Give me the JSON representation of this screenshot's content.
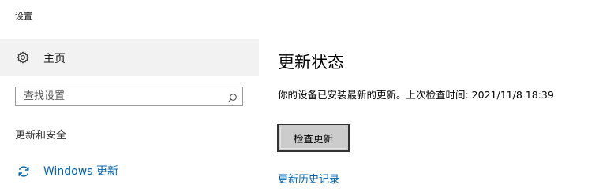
{
  "window": {
    "title": "设置"
  },
  "sidebar": {
    "home": {
      "label": "主页",
      "icon": "gear-icon"
    },
    "search": {
      "placeholder": "查找设置",
      "value": "",
      "icon": "search-icon"
    },
    "section_title": "更新和安全",
    "items": [
      {
        "label": "Windows 更新",
        "icon": "refresh-icon",
        "active": true
      }
    ]
  },
  "main": {
    "title": "更新状态",
    "status_text": "你的设备已安装最新的更新。上次检查时间: 2021/11/8 18:39",
    "check_button_label": "检查更新",
    "history_link": "更新历史记录"
  },
  "colors": {
    "accent": "#0063b1",
    "sidebar_highlight": "#f2f2f2",
    "button_bg": "#cccccc",
    "button_border": "#333333"
  }
}
